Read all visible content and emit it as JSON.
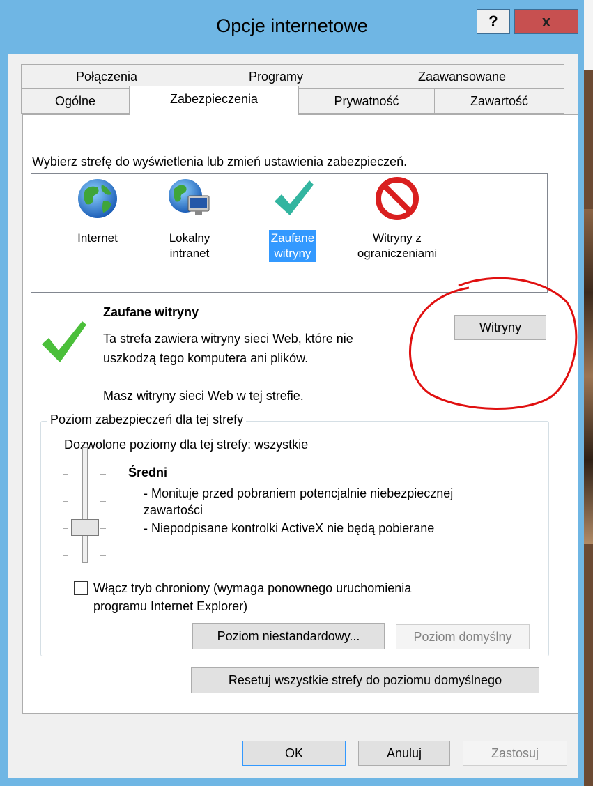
{
  "window": {
    "title": "Opcje internetowe",
    "help_label": "?",
    "close_label": "x"
  },
  "tabs_row_back": [
    {
      "label": "Połączenia"
    },
    {
      "label": "Programy"
    },
    {
      "label": "Zaawansowane"
    }
  ],
  "tabs_row_front": [
    {
      "label": "Ogólne"
    },
    {
      "label": "Zabezpieczenia",
      "active": true
    },
    {
      "label": "Prywatność"
    },
    {
      "label": "Zawartość"
    }
  ],
  "security": {
    "instruction": "Wybierz strefę do wyświetlenia lub zmień ustawienia zabezpieczeń.",
    "zones": [
      {
        "line1": "Internet",
        "line2": "",
        "icon": "globe-icon"
      },
      {
        "line1": "Lokalny",
        "line2": "intranet",
        "icon": "intranet-icon"
      },
      {
        "line1": "Zaufane",
        "line2": "witryny",
        "icon": "checkmark-icon",
        "selected": true
      },
      {
        "line1": "Witryny z",
        "line2": "ograniczeniami",
        "icon": "restricted-icon"
      }
    ],
    "selected_zone_title": "Zaufane witryny",
    "selected_zone_desc_1": "Ta strefa zawiera witryny sieci Web, które nie",
    "selected_zone_desc_2": "uszkodzą tego komputera ani plików.",
    "selected_zone_note": "Masz witryny sieci Web w tej strefie.",
    "sites_button": "Witryny",
    "level_group_label": "Poziom zabezpieczeń dla tej strefy",
    "allowed_levels": "Dozwolone poziomy dla tej strefy: wszystkie",
    "level_name": "Średni",
    "level_desc_1": "- Monituje przed pobraniem potencjalnie niebezpiecznej",
    "level_desc_2": "zawartości",
    "level_desc_3": "- Niepodpisane kontrolki ActiveX nie będą pobierane",
    "slider_level": "2 of 4",
    "protected_mode_line1": "Włącz tryb chroniony (wymaga ponownego uruchomienia",
    "protected_mode_line2": "programu Internet Explorer)",
    "protected_mode_checked": false,
    "custom_level_button": "Poziom niestandardowy...",
    "default_level_button": "Poziom domyślny",
    "reset_all_button": "Resetuj wszystkie strefy do poziomu domyślnego"
  },
  "footer": {
    "ok": "OK",
    "cancel": "Anuluj",
    "apply": "Zastosuj"
  },
  "colors": {
    "title_bar": "#6fb6e4",
    "close_button": "#c75050",
    "selection": "#3399ff",
    "annotation": "#e01010"
  }
}
